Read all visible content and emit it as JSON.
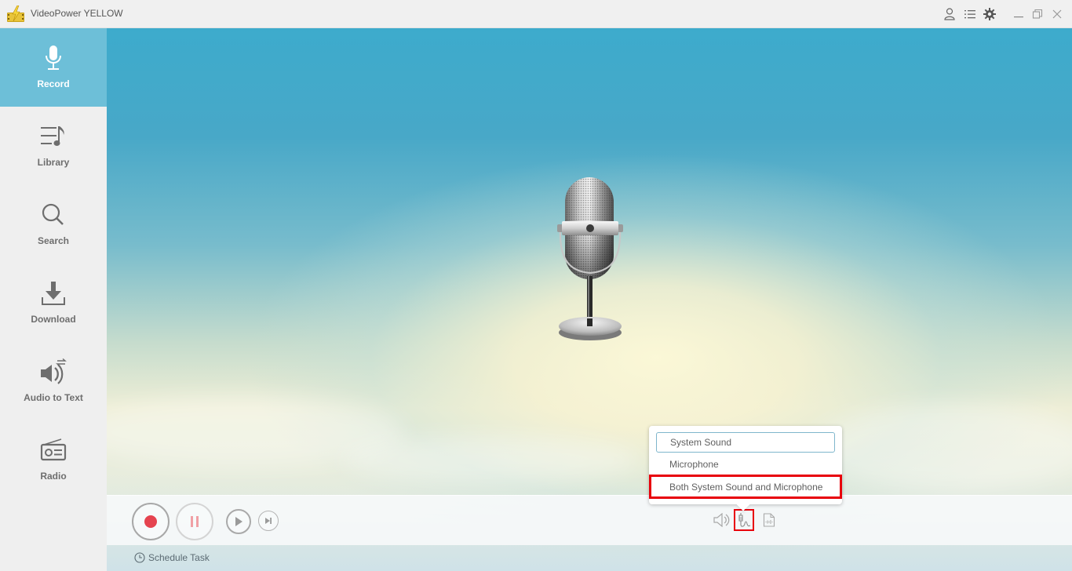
{
  "app": {
    "title": "VideoPower YELLOW"
  },
  "titlebar": {
    "icons": [
      {
        "name": "user-icon",
        "label": "account"
      },
      {
        "name": "menu-list-icon",
        "label": "menu"
      },
      {
        "name": "gear-icon",
        "label": "settings"
      },
      {
        "name": "minimize-icon",
        "label": "minimize"
      },
      {
        "name": "restore-icon",
        "label": "restore"
      },
      {
        "name": "close-icon",
        "label": "close"
      }
    ]
  },
  "sidebar": {
    "items": [
      {
        "label": "Record",
        "icon": "microphone-icon",
        "active": true
      },
      {
        "label": "Library",
        "icon": "music-list-icon",
        "active": false
      },
      {
        "label": "Search",
        "icon": "search-icon",
        "active": false
      },
      {
        "label": "Download",
        "icon": "download-icon",
        "active": false
      },
      {
        "label": "Audio to Text",
        "icon": "speaker-convert-icon",
        "active": false
      },
      {
        "label": "Radio",
        "icon": "radio-icon",
        "active": false
      }
    ],
    "active_color": "#6dbfd8"
  },
  "main": {
    "hero_image": "vintage-microphone-icon"
  },
  "controls": {
    "record_color": "#e5434f",
    "buttons": [
      "record",
      "pause",
      "play",
      "next"
    ],
    "audio_source_icons": [
      "speaker-icon",
      "audio-jack-icon",
      "audio-file-icon"
    ]
  },
  "audio_source_menu": {
    "options": [
      {
        "label": "System Sound",
        "selected": true
      },
      {
        "label": "Microphone",
        "selected": false
      },
      {
        "label": "Both System Sound and Microphone",
        "selected": false,
        "highlighted": true
      }
    ],
    "highlight_color": "#e8000b"
  },
  "bottom": {
    "schedule_label": "Schedule Task"
  }
}
